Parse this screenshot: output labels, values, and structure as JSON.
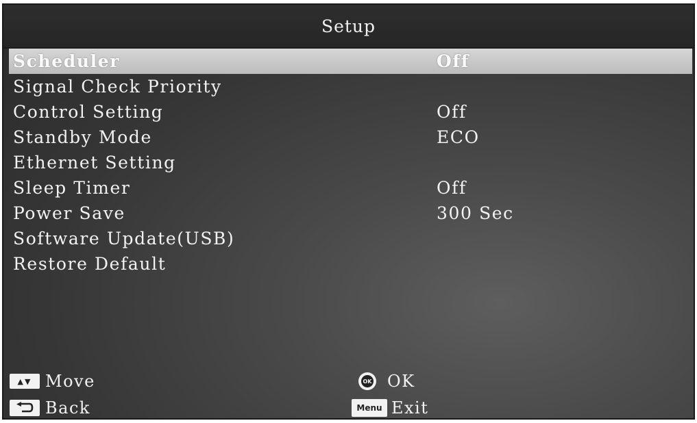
{
  "header": {
    "title": "Setup"
  },
  "menu": {
    "items": [
      {
        "label": "Scheduler",
        "value": "Off",
        "selected": true
      },
      {
        "label": "Signal Check Priority",
        "value": ""
      },
      {
        "label": "Control Setting",
        "value": "Off"
      },
      {
        "label": "Standby Mode",
        "value": "ECO"
      },
      {
        "label": "Ethernet Setting",
        "value": ""
      },
      {
        "label": "Sleep Timer",
        "value": "Off"
      },
      {
        "label": "Power Save",
        "value": "300 Sec"
      },
      {
        "label": "Software Update(USB)",
        "value": ""
      },
      {
        "label": "Restore Default",
        "value": ""
      }
    ]
  },
  "footer": {
    "move": {
      "icon_text": "▲▼",
      "label": "Move"
    },
    "back": {
      "label": "Back"
    },
    "ok": {
      "icon_text": "OK",
      "label": "OK"
    },
    "exit": {
      "icon_text": "Menu",
      "label": "Exit"
    }
  },
  "colors": {
    "background": "#3c3c3c",
    "title_bar": "#2a2a2a",
    "highlight": "#c8c8c8",
    "text": "#f2f2f2"
  },
  "icons": {
    "move": "up-down-arrows-icon",
    "back": "return-arrow-icon",
    "ok": "ok-circle-icon",
    "exit": "menu-key-icon"
  }
}
